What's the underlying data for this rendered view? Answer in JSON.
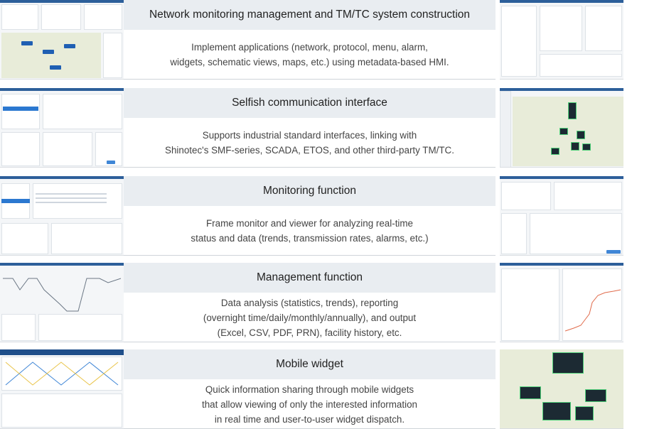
{
  "rows": [
    {
      "title": "Network monitoring management and TM/TC system construction",
      "desc": [
        "Implement applications (network, protocol, menu, alarm,",
        "widgets, schematic views, maps, etc.) using metadata-based HMI."
      ]
    },
    {
      "title": "Selfish communication interface",
      "desc": [
        "Supports industrial standard interfaces, linking with",
        "Shinotec's SMF-series, SCADA, ETOS, and other third-party TM/TC."
      ]
    },
    {
      "title": "Monitoring function",
      "desc": [
        "Frame monitor and viewer for analyzing real-time",
        "status and data (trends, transmission rates, alarms, etc.)"
      ]
    },
    {
      "title": "Management function",
      "desc": [
        "Data analysis (statistics, trends), reporting",
        "(overnight time/daily/monthly/annually), and output",
        "(Excel, CSV, PDF, PRN), facility history, etc."
      ]
    },
    {
      "title": "Mobile widget",
      "desc": [
        "Quick information sharing through mobile widgets",
        "that allow viewing of only the interested information",
        "in real time and user-to-user widget dispatch."
      ]
    }
  ],
  "colors": {
    "title_bg": "#e9edf1",
    "accent": "#2d5f9a",
    "button": "#3f86d6"
  }
}
